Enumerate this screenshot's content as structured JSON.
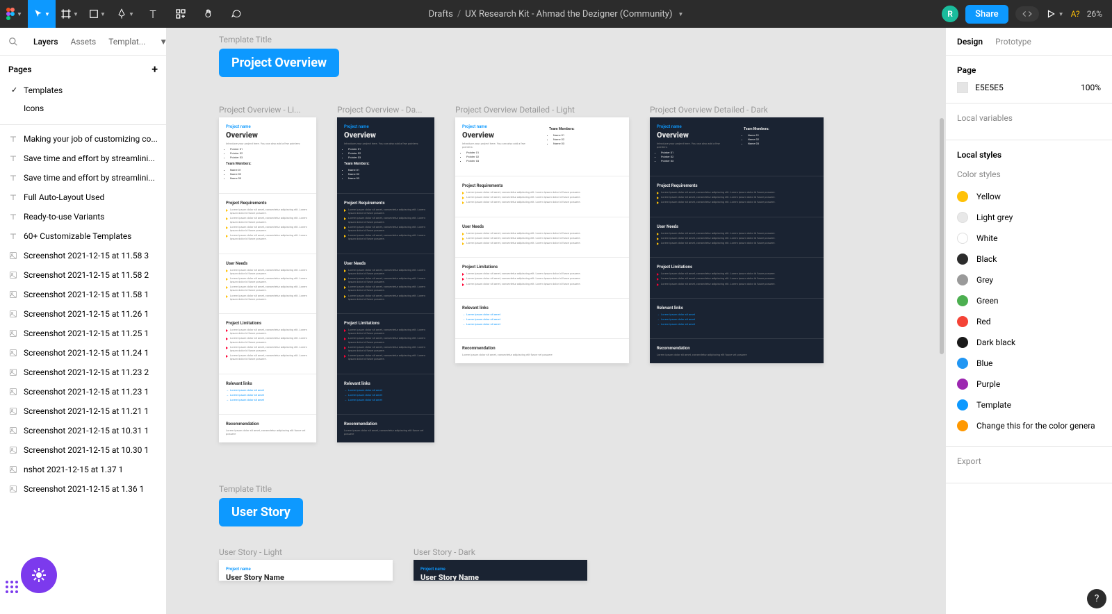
{
  "toolbar": {
    "breadcrumb_root": "Drafts",
    "breadcrumb_file": "UX Research Kit - Ahmad the Dezigner (Community)",
    "avatar_letter": "R",
    "share_label": "Share",
    "missing_fonts": "A?",
    "zoom": "26%"
  },
  "left": {
    "tab_layers": "Layers",
    "tab_assets": "Assets",
    "tab_templates": "Templat...",
    "pages_label": "Pages",
    "pages": [
      {
        "label": "Templates",
        "selected": true
      },
      {
        "label": "Icons",
        "selected": false
      }
    ],
    "layers": [
      {
        "type": "text",
        "label": "Making your job of customizing co..."
      },
      {
        "type": "text",
        "label": "Save time and effort by streamlini..."
      },
      {
        "type": "text",
        "label": "Save time and effort by streamlini..."
      },
      {
        "type": "text",
        "label": "Full Auto-Layout Used"
      },
      {
        "type": "text",
        "label": "Ready-to-use Variants"
      },
      {
        "type": "text",
        "label": "60+ Customizable Templates"
      },
      {
        "type": "image",
        "label": "Screenshot 2021-12-15 at 11.58 3"
      },
      {
        "type": "image",
        "label": "Screenshot 2021-12-15 at 11.58 2"
      },
      {
        "type": "image",
        "label": "Screenshot 2021-12-15 at 11.58 1"
      },
      {
        "type": "image",
        "label": "Screenshot 2021-12-15 at 11.26 1"
      },
      {
        "type": "image",
        "label": "Screenshot 2021-12-15 at 11.25 1"
      },
      {
        "type": "image",
        "label": "Screenshot 2021-12-15 at 11.24 1"
      },
      {
        "type": "image",
        "label": "Screenshot 2021-12-15 at 11.23 2"
      },
      {
        "type": "image",
        "label": "Screenshot 2021-12-15 at 11.23 1"
      },
      {
        "type": "image",
        "label": "Screenshot 2021-12-15 at 11.21 1"
      },
      {
        "type": "image",
        "label": "Screenshot 2021-12-15 at 10.31 1"
      },
      {
        "type": "image",
        "label": "Screenshot 2021-12-15 at 10.30 1"
      },
      {
        "type": "image",
        "label": "nshot 2021-12-15 at 1.37 1"
      },
      {
        "type": "image",
        "label": "Screenshot 2021-12-15 at 1.36 1"
      }
    ]
  },
  "canvas": {
    "section1_label": "Template Title",
    "section1_title": "Project Overview",
    "frames1": [
      {
        "label": "Project Overview - Li...",
        "dark": false,
        "wide": false
      },
      {
        "label": "Project Overview - Da...",
        "dark": true,
        "wide": false
      },
      {
        "label": "Project Overview Detailed - Light",
        "dark": false,
        "wide": true
      },
      {
        "label": "Project Overview Detailed - Dark",
        "dark": true,
        "wide": true
      }
    ],
    "section2_label": "Template Title",
    "section2_title": "User Story",
    "frames2": [
      {
        "label": "User Story - Light",
        "dark": false
      },
      {
        "label": "User Story - Dark",
        "dark": true
      }
    ],
    "content": {
      "project_name": "Project name",
      "overview": "Overview",
      "user_story_name": "User Story Name",
      "intro": "Introduce your project here. You can also add a few pointers:",
      "pointers": [
        "Pointer 01",
        "Pointer 02",
        "Pointer 03"
      ],
      "team_label": "Team Members:",
      "team": [
        "Name 01",
        "Name 02",
        "Name 03"
      ],
      "req_title": "Project Requirements",
      "needs_title": "User Needs",
      "limits_title": "Project Limitations",
      "links_title": "Relevant links",
      "rec_title": "Recommendation",
      "lorem": "Lorem ipsum dolor sit amet, consectetur adipiscing elit. Lorem ipsum dolor id fusce posuere.",
      "lorem_short": "Lorem ipsum dolor sit amet, consectetur adipiscing elit fusce vel posuere",
      "link_text": "Lorem ipsum dolor sit amet"
    }
  },
  "right": {
    "tab_design": "Design",
    "tab_prototype": "Prototype",
    "page_label": "Page",
    "page_color": "E5E5E5",
    "page_opacity": "100%",
    "local_vars": "Local variables",
    "local_styles": "Local styles",
    "color_styles_label": "Color styles",
    "colors": [
      {
        "name": "Yellow",
        "hex": "#ffc107"
      },
      {
        "name": "Light grey",
        "hex": "#e8e8e8"
      },
      {
        "name": "White",
        "hex": "#ffffff"
      },
      {
        "name": "Black",
        "hex": "#2c2c2c"
      },
      {
        "name": "Grey",
        "hex": "#9a9a9a"
      },
      {
        "name": "Green",
        "hex": "#4caf50"
      },
      {
        "name": "Red",
        "hex": "#f44336"
      },
      {
        "name": "Dark black",
        "hex": "#1a1a1a"
      },
      {
        "name": "Blue",
        "hex": "#2196f3"
      },
      {
        "name": "Purple",
        "hex": "#9c27b0"
      },
      {
        "name": "Template",
        "hex": "#0d99ff"
      },
      {
        "name": "Change this for the color genera",
        "hex": "#ff9800"
      }
    ],
    "export_label": "Export"
  }
}
